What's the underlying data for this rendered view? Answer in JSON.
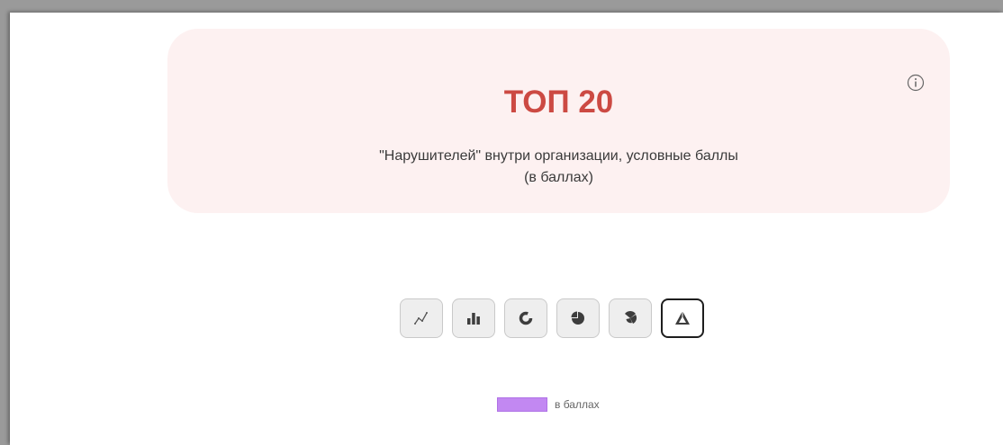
{
  "card": {
    "title": "ТОП 20",
    "subtitle_line1": "\"Нарушителей\" внутри организации, условные баллы",
    "subtitle_line2": "(в баллах)"
  },
  "chart_type_buttons": [
    {
      "icon": "line-chart-icon",
      "active": false
    },
    {
      "icon": "bar-chart-icon",
      "active": false
    },
    {
      "icon": "donut-chart-icon",
      "active": false
    },
    {
      "icon": "pie-chart-icon",
      "active": false
    },
    {
      "icon": "polar-area-chart-icon",
      "active": false
    },
    {
      "icon": "radar-chart-icon",
      "active": true
    }
  ],
  "legend": {
    "label": "в баллах",
    "color": "#c288f2"
  },
  "colors": {
    "title": "#cc4a43",
    "card_background": "#fdf1f1",
    "legend_swatch": "#c288f2"
  }
}
